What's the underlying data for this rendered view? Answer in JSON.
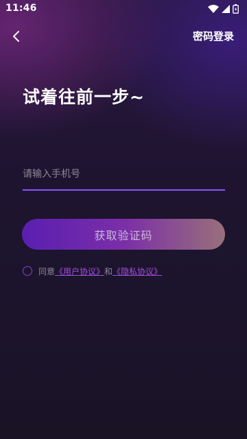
{
  "status_bar": {
    "time": "11:46",
    "icons": [
      "wifi-icon",
      "signal-icon",
      "battery-icon"
    ]
  },
  "header": {
    "back_icon": "chevron-left-icon",
    "password_login_label": "密码登录"
  },
  "main": {
    "title": "试着往前一步~",
    "phone_input": {
      "placeholder": "请输入手机号",
      "value": ""
    },
    "get_code_label": "获取验证码"
  },
  "agreement": {
    "checked": false,
    "prefix": "同意",
    "user_agreement": "《用户协议》",
    "and": "和",
    "privacy_policy": "《隐私协议》"
  },
  "colors": {
    "accent": "#8a54ff",
    "link": "#a24fe0",
    "button_start": "#5a1fb0",
    "button_end": "#98707a"
  }
}
